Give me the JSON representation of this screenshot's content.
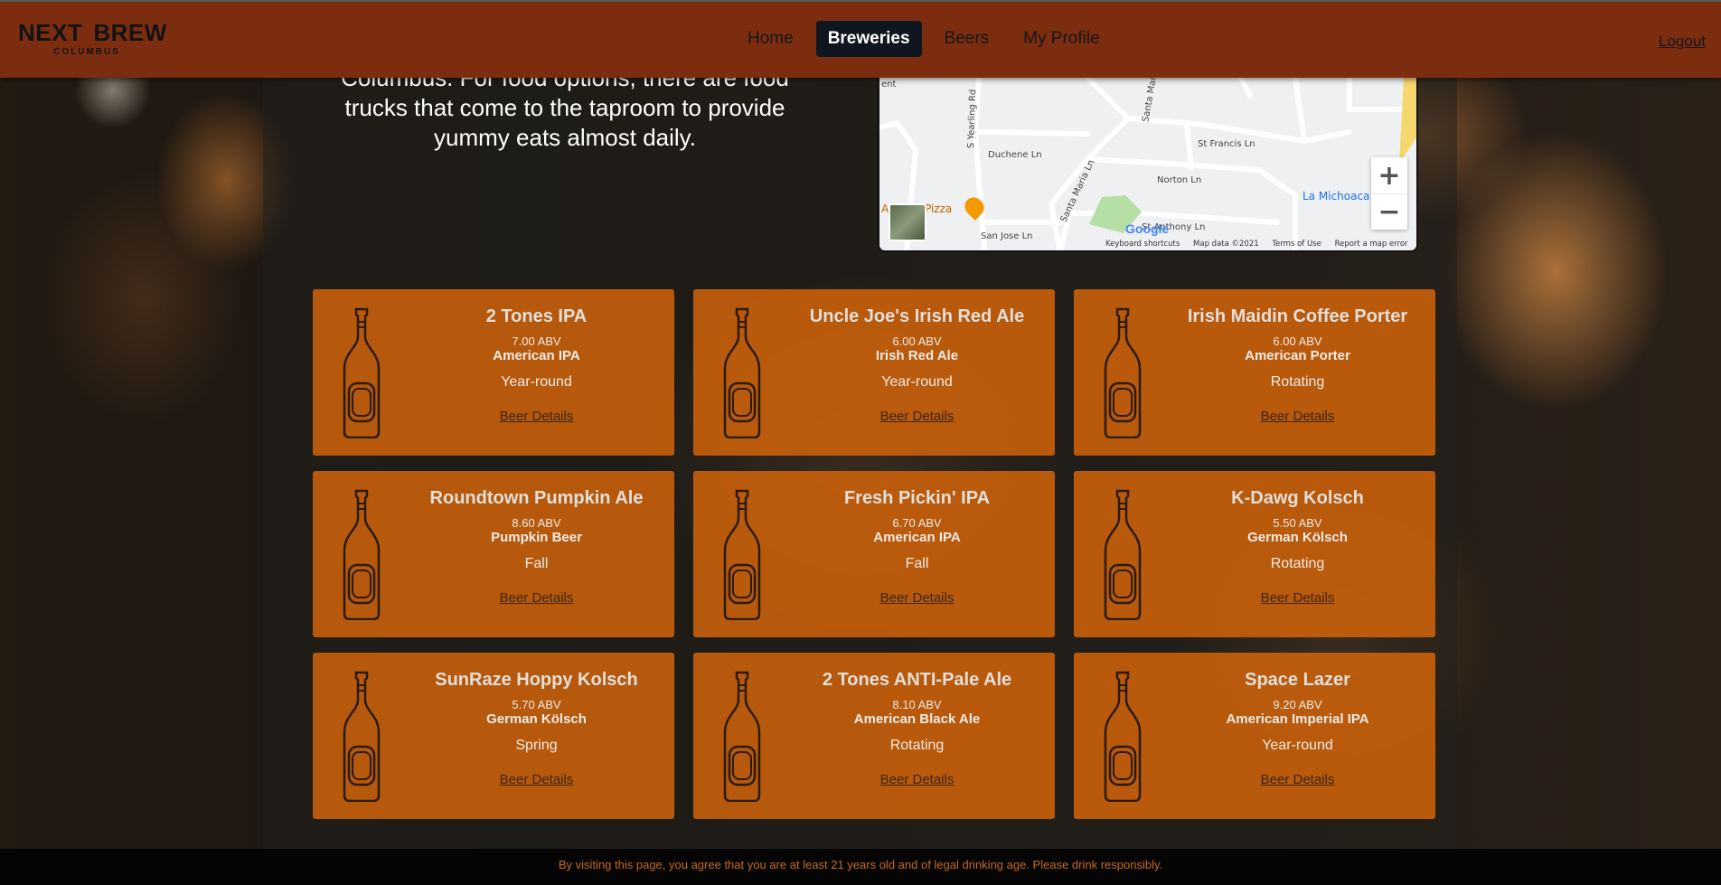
{
  "header": {
    "logo_text_left": "NEXT",
    "logo_text_right": "BREW",
    "logo_sub": "COLUMBUS",
    "nav": [
      {
        "label": "Home",
        "active": false
      },
      {
        "label": "Breweries",
        "active": true
      },
      {
        "label": "Beers",
        "active": false
      },
      {
        "label": "My Profile",
        "active": false
      }
    ],
    "logout_label": "Logout"
  },
  "intro": {
    "text": "Columbus. For food options, there are food trucks that come to the taproom to provide yummy eats almost daily."
  },
  "map": {
    "streets": [
      "S Yearling Rd",
      "Santa Maria",
      "Duchene Ln",
      "St Francis Ln",
      "Norton Ln",
      "Santa Maria Ln",
      "St Anthony Ln",
      "San Jose Ln",
      "ent"
    ],
    "places": [
      "La Michoaca",
      "A",
      "Pizza"
    ],
    "google_label": "Google",
    "footer": [
      "Keyboard shortcuts",
      "Map data ©2021",
      "Terms of Use",
      "Report a map error"
    ],
    "zoom_in": "+",
    "zoom_out": "−"
  },
  "beers": [
    {
      "name": "2 Tones IPA",
      "abv": "7.00 ABV",
      "style": "American IPA",
      "season": "Year-round",
      "details_label": "Beer Details"
    },
    {
      "name": "Uncle Joe's Irish Red Ale",
      "abv": "6.00 ABV",
      "style": "Irish Red Ale",
      "season": "Year-round",
      "details_label": "Beer Details"
    },
    {
      "name": "Irish Maidin Coffee Porter",
      "abv": "6.00 ABV",
      "style": "American Porter",
      "season": "Rotating",
      "details_label": "Beer Details"
    },
    {
      "name": "Roundtown Pumpkin Ale",
      "abv": "8.60 ABV",
      "style": "Pumpkin Beer",
      "season": "Fall",
      "details_label": "Beer Details"
    },
    {
      "name": "Fresh Pickin' IPA",
      "abv": "6.70 ABV",
      "style": "American IPA",
      "season": "Fall",
      "details_label": "Beer Details"
    },
    {
      "name": "K-Dawg Kolsch",
      "abv": "5.50 ABV",
      "style": "German Kölsch",
      "season": "Rotating",
      "details_label": "Beer Details"
    },
    {
      "name": "SunRaze Hoppy Kolsch",
      "abv": "5.70 ABV",
      "style": "German Kölsch",
      "season": "Spring",
      "details_label": "Beer Details"
    },
    {
      "name": "2 Tones ANTI-Pale Ale",
      "abv": "8.10 ABV",
      "style": "American Black Ale",
      "season": "Rotating",
      "details_label": "Beer Details"
    },
    {
      "name": "Space Lazer",
      "abv": "9.20 ABV",
      "style": "American Imperial IPA",
      "season": "Year-round",
      "details_label": "Beer Details"
    }
  ],
  "footer": {
    "disclaimer": "By visiting this page, you agree that you are at least 21 years old and of legal drinking age. Please drink responsibly."
  },
  "colors": {
    "header_bg": "#7d2d0f",
    "card_bg": "#d2640a",
    "nav_active_bg": "#0f1620",
    "footer_text": "#c86a1a"
  }
}
